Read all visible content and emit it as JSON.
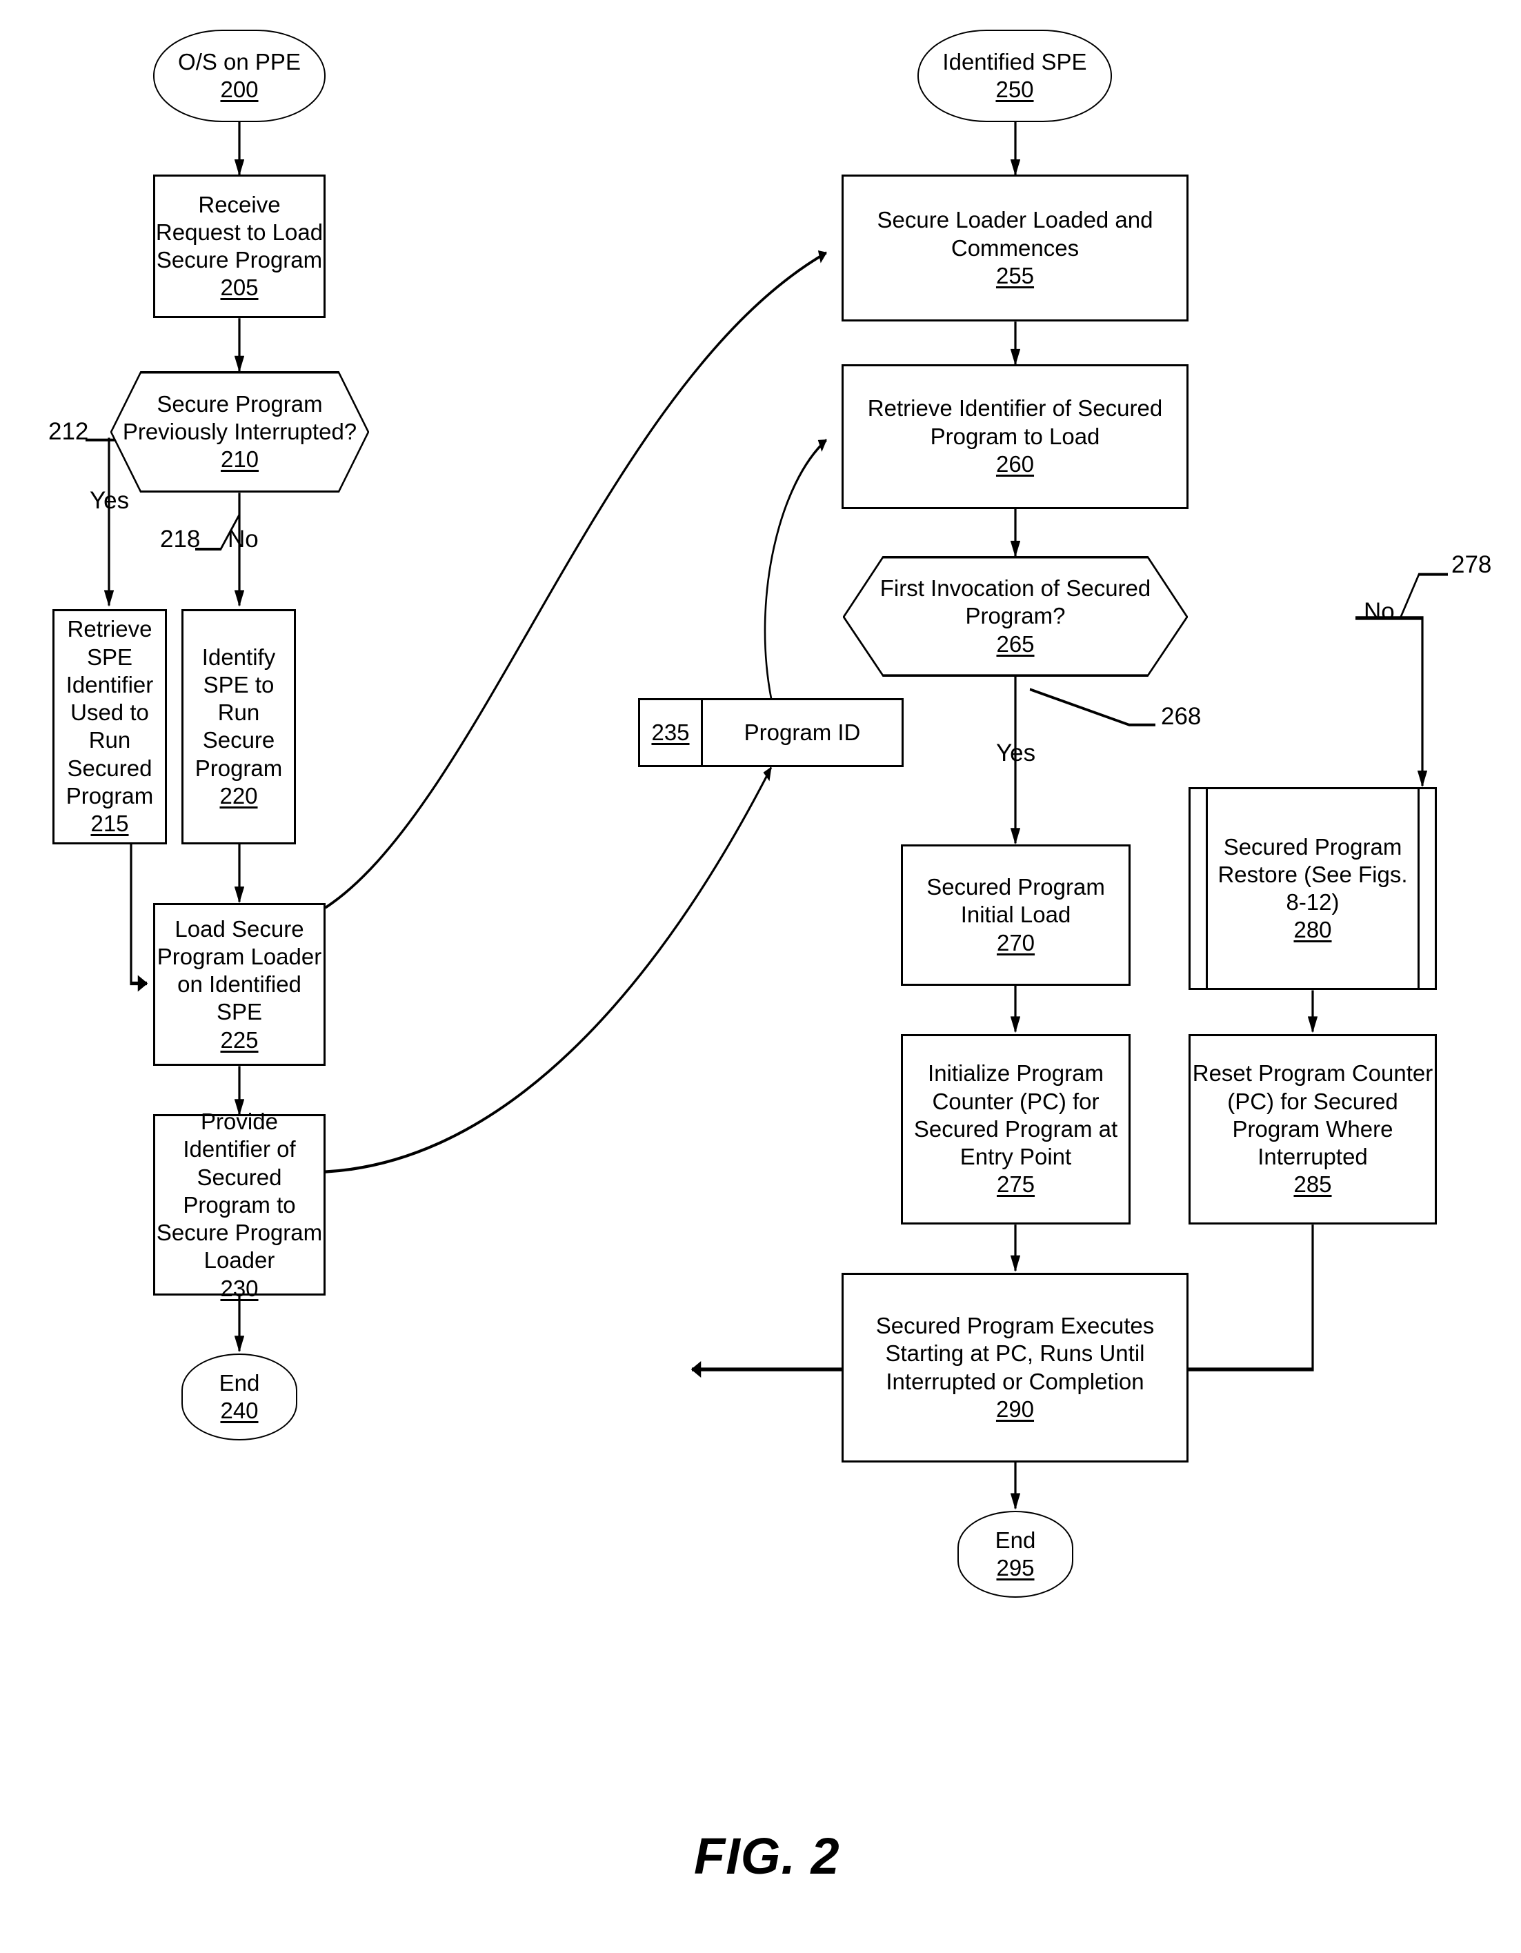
{
  "figure": {
    "caption": "FIG. 2"
  },
  "left_flow": {
    "start": {
      "title": "O/S on PPE",
      "ref": "200"
    },
    "step_205": {
      "title": "Receive Request to Load Secure Program",
      "ref": "205"
    },
    "decision_210": {
      "title": "Secure Program Previously Interrupted?",
      "ref": "210"
    },
    "branch_yes_label": "Yes",
    "branch_yes_ref": "212",
    "branch_no_label": "No",
    "branch_no_ref": "218",
    "step_215": {
      "title": "Retrieve SPE Identifier Used to Run Secured Program",
      "ref": "215"
    },
    "step_220": {
      "title": "Identify SPE to Run Secure Program",
      "ref": "220"
    },
    "step_225": {
      "title": "Load Secure Program Loader on Identified SPE",
      "ref": "225"
    },
    "step_230": {
      "title": "Provide Identifier of Secured Program to Secure Program Loader",
      "ref": "230"
    },
    "end": {
      "title": "End",
      "ref": "240"
    }
  },
  "datastore_235": {
    "ref": "235",
    "label": "Program ID"
  },
  "right_flow": {
    "start": {
      "title": "Identified SPE",
      "ref": "250"
    },
    "step_255": {
      "title": "Secure Loader Loaded and Commences",
      "ref": "255"
    },
    "step_260": {
      "title": "Retrieve Identifier of Secured Program to Load",
      "ref": "260"
    },
    "decision_265": {
      "title": "First Invocation of Secured Program?",
      "ref": "265"
    },
    "branch_yes_label": "Yes",
    "branch_yes_ref": "268",
    "branch_no_label": "No",
    "branch_no_ref": "278",
    "step_270": {
      "title": "Secured Program Initial Load",
      "ref": "270"
    },
    "step_280": {
      "title": "Secured Program Restore (See Figs. 8-12)",
      "ref": "280"
    },
    "step_275": {
      "title": "Initialize Program Counter (PC) for Secured Program at Entry Point",
      "ref": "275"
    },
    "step_285": {
      "title": "Reset Program Counter (PC) for Secured Program Where Interrupted",
      "ref": "285"
    },
    "step_290": {
      "title": "Secured Program Executes Starting at PC, Runs Until Interrupted or Completion",
      "ref": "290"
    },
    "end": {
      "title": "End",
      "ref": "295"
    }
  },
  "colors": {
    "stroke": "#000000",
    "background": "#ffffff"
  }
}
